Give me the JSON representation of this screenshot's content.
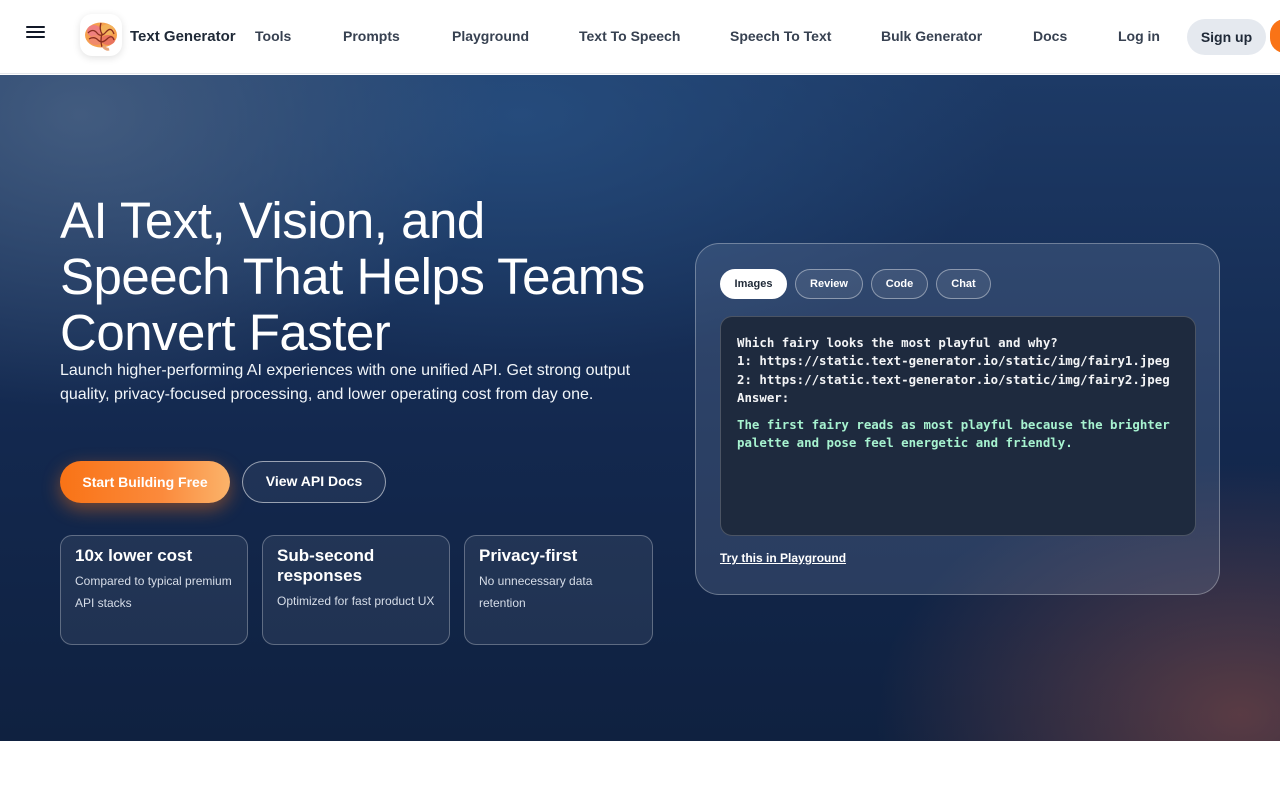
{
  "header": {
    "brand": "Text Generator",
    "nav": [
      "Tools",
      "Prompts",
      "Playground",
      "Text To Speech",
      "Speech To Text",
      "Bulk Generator",
      "Docs"
    ],
    "login": "Log in",
    "signup": "Sign up",
    "icons": {
      "menu": "hamburger-menu-icon",
      "logo": "brain-logo-icon"
    }
  },
  "hero": {
    "title_lines": [
      "AI Text, Vision, and",
      "Speech That Helps Teams",
      "Convert Faster"
    ],
    "subtitle": "Launch higher-performing AI experiences with one unified API. Get strong output quality, privacy-focused processing, and lower operating cost from day one.",
    "primary_cta": "Start Building Free",
    "secondary_cta": "View API Docs",
    "stats": [
      {
        "title": "10x lower cost",
        "desc": "Compared to typical premium API stacks"
      },
      {
        "title": "Sub-second responses",
        "desc": "Optimized for fast product UX"
      },
      {
        "title": "Privacy-first",
        "desc": "No unnecessary data retention"
      }
    ]
  },
  "demo": {
    "tabs": [
      "Images",
      "Review",
      "Code",
      "Chat"
    ],
    "active_tab": "Images",
    "prompt_lines": [
      "Which fairy looks the most playful and why?",
      "1: https://static.text-generator.io/static/img/fairy1.jpeg",
      "2: https://static.text-generator.io/static/img/fairy2.jpeg",
      "Answer:"
    ],
    "answer": "The first fairy reads as most playful because the brighter palette and pose feel energetic and friendly.",
    "link": "Try this in Playground"
  },
  "colors": {
    "accent": "#f97316",
    "hero_bg": "#13284e",
    "answer_text": "#a7f3d0"
  }
}
